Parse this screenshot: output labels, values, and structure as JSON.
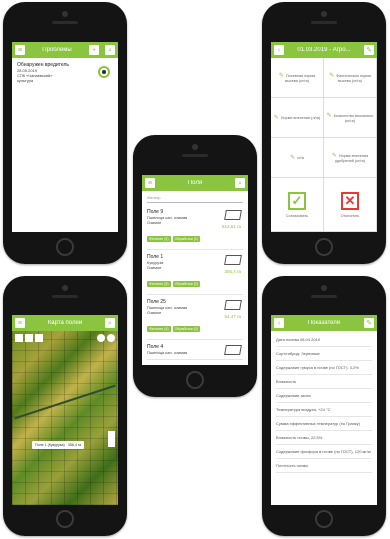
{
  "colors": {
    "brand": "#8bc53f",
    "confirm": "#8bc53f",
    "reject": "#e53935"
  },
  "problems": {
    "title": "Проблемы",
    "item_title": "Обнаружен вредитель",
    "item_date": "28.05.2019",
    "item_line2": "СПК «Чапаевский»",
    "item_line3": "культура"
  },
  "fields": {
    "title": "Поля",
    "filter": "Фильтр",
    "items": [
      {
        "name": "Поле 9",
        "line1": "Пшеница кап. озимая",
        "line2": "Озимое",
        "badge1": "Фенотип (4)",
        "badge2": "Обработки (1)",
        "area": "812,61 га"
      },
      {
        "name": "Поле 1",
        "line1": "Кукуруза",
        "line2": "Озимое",
        "badge1": "Фенотип (8)",
        "badge2": "Обработки (2)",
        "area": "356,4 га"
      },
      {
        "name": "Поле 25",
        "line1": "Пшеница кап. озимая",
        "line2": "Озимое",
        "badge1": "Фенотип (4)",
        "badge2": "Обработки (2)",
        "area": "54,47 га"
      },
      {
        "name": "Поле 4",
        "line1": "Пшеница кап. озимая",
        "line2": "",
        "badge1": "",
        "badge2": "",
        "area": ""
      }
    ]
  },
  "plan": {
    "title": "01.03.2019 - Агро...",
    "cells": [
      "Посевная норма высева (кг/га)",
      "Фактическая норма высева (кг/га)",
      "Норма внесения (л/га)",
      "Количество вносимого (кг/га)",
      "л/га",
      "Норма внесения удобрений (кг/га)"
    ],
    "confirm_label": "Согласовать",
    "reject_label": "Отклонить"
  },
  "map": {
    "title": "Карта полей",
    "popup": "Поле 1 (Кукуруза) · 356,4 га"
  },
  "indicators": {
    "title": "Показатели",
    "rows": [
      "Дата посева 08.04.2019",
      "Сорт/гибрид: Зерновые",
      "Содержание гумуса в почве (по ГОСТ): 3,2%",
      "Влажность",
      "Содержание азота",
      "Температура воздуха, +24 °C",
      "Сумма эффективных температур (по Гранку)",
      "Влажность почвы, 22,5%",
      "Содержание фосфора в почве (по ГОСТ), 120 мг/кг",
      "Плотность почвы"
    ]
  }
}
